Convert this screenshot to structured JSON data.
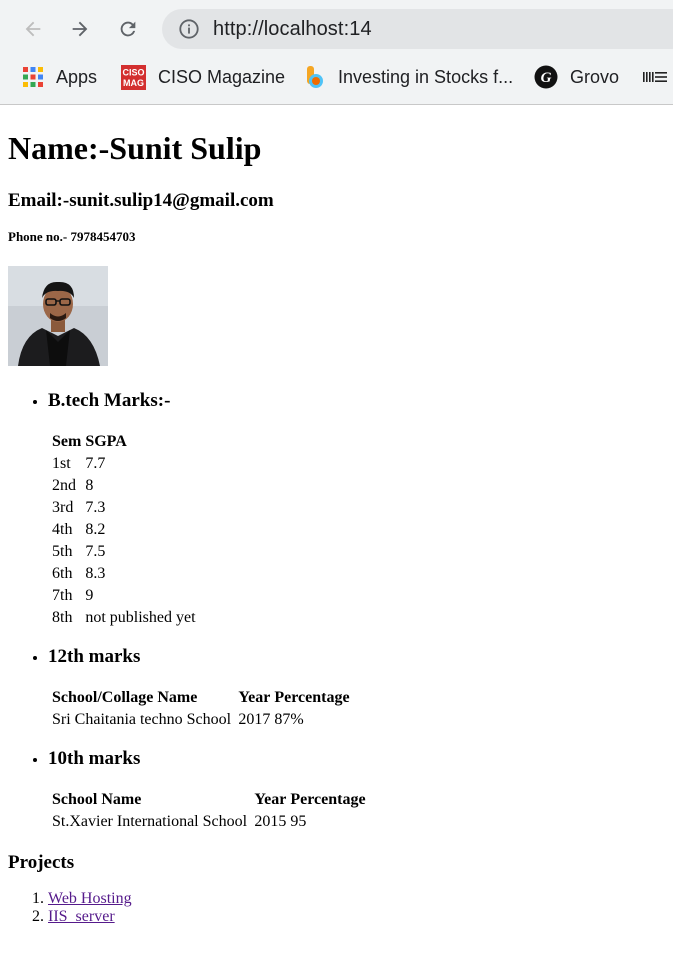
{
  "browser": {
    "url": "http://localhost:14",
    "bookmarks": [
      {
        "label": "Apps",
        "icon": "apps-grid-icon"
      },
      {
        "label": "CISO Magazine",
        "icon": "ciso-mag-icon"
      },
      {
        "label": "Investing in Stocks f...",
        "icon": "investing-icon"
      },
      {
        "label": "Grovo",
        "icon": "grovo-icon"
      }
    ],
    "ciso_logo_text": [
      "CISO",
      "MAG"
    ],
    "grovo_logo_text": "G"
  },
  "profile": {
    "name": "Name:-Sunit Sulip",
    "email": "Email:-sunit.sulip14@gmail.com",
    "phone": "Phone no.- 7978454703"
  },
  "btech": {
    "title": "B.tech Marks:-",
    "headers": [
      "Sem",
      "SGPA"
    ],
    "rows": [
      [
        "1st",
        "7.7"
      ],
      [
        "2nd",
        "8"
      ],
      [
        "3rd",
        "7.3"
      ],
      [
        "4th",
        "8.2"
      ],
      [
        "5th",
        "7.5"
      ],
      [
        "6th",
        "8.3"
      ],
      [
        "7th",
        "9"
      ],
      [
        "8th",
        "not published yet"
      ]
    ]
  },
  "twelfth": {
    "title": "12th marks",
    "headers": [
      "School/Collage Name",
      "Year",
      "Percentage"
    ],
    "rows": [
      [
        "Sri Chaitania techno School",
        "2017",
        "87%"
      ]
    ]
  },
  "tenth": {
    "title": "10th marks",
    "headers": [
      "School Name",
      "Year",
      "Percentage"
    ],
    "rows": [
      [
        "St.Xavier International School",
        "2015",
        "95"
      ]
    ]
  },
  "projects": {
    "title": "Projects",
    "items": [
      "Web Hosting",
      "IIS_server"
    ]
  },
  "colors": {
    "visited_link": "#551a8b",
    "chrome_bg": "#f1f3f4",
    "omnibox_bg": "#e2e4e6"
  }
}
